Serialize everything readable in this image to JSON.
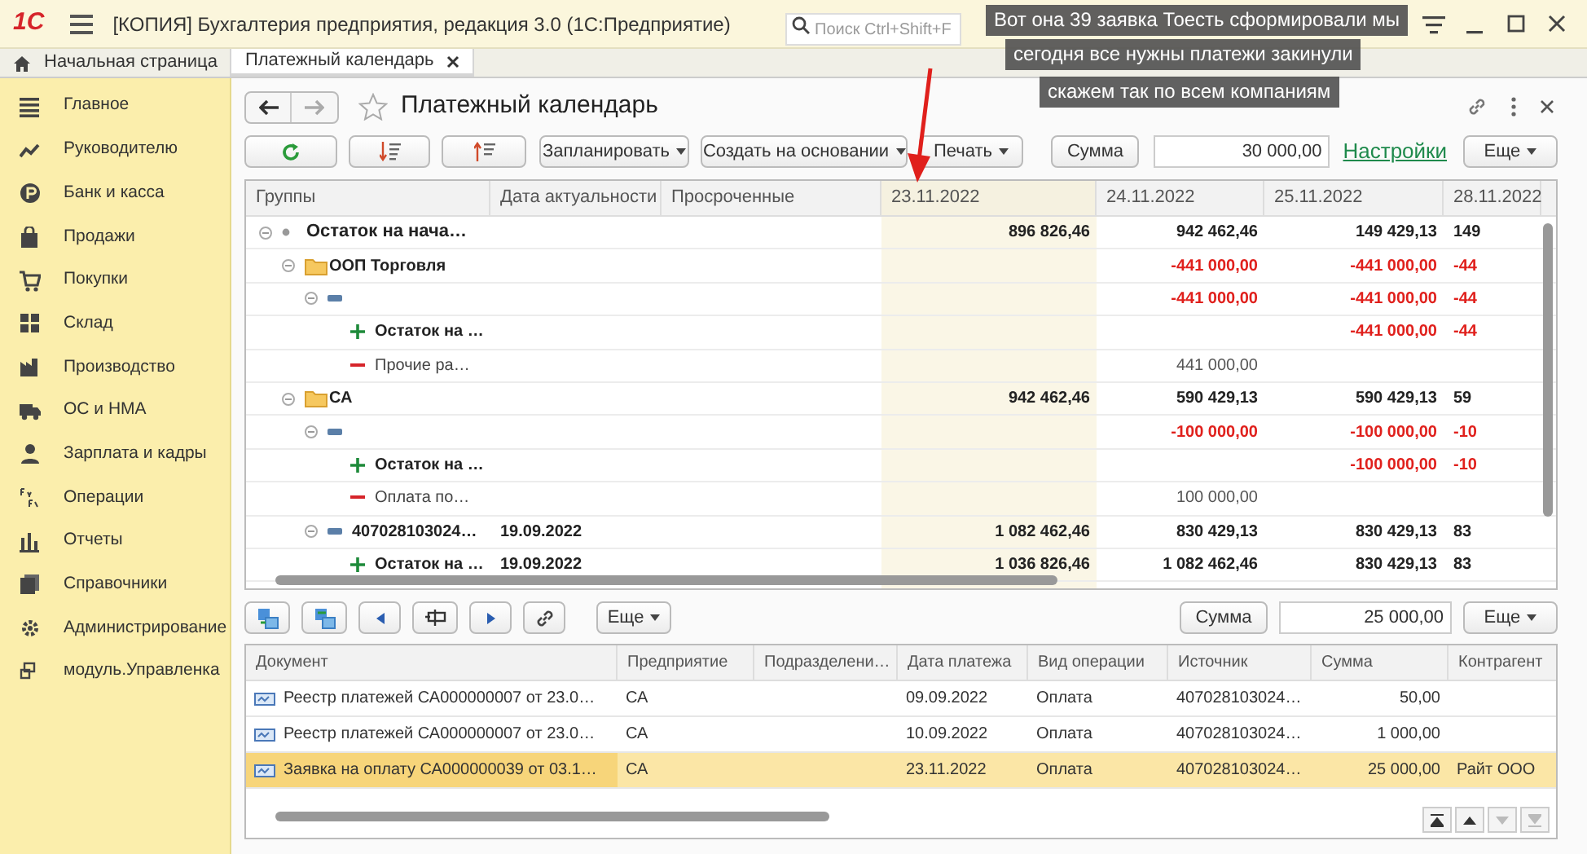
{
  "window": {
    "logo": "1С",
    "title": "[КОПИЯ] Бухгалтерия предприятия, редакция 3.0  (1С:Предприятие)",
    "search": {
      "placeholder": "Поиск Ctrl+Shift+F"
    }
  },
  "captions": [
    "Вот она 39 заявка Тоесть сформировали мы",
    "сегодня все нужны платежи закинули",
    "скажем так по всем компаниям"
  ],
  "tabs": [
    {
      "label": "Начальная страница",
      "selected": false,
      "closable": false
    },
    {
      "label": "Платежный календарь",
      "selected": true,
      "closable": true
    }
  ],
  "sidebar": {
    "items": [
      {
        "label": "Главное"
      },
      {
        "label": "Руководителю"
      },
      {
        "label": "Банк и касса"
      },
      {
        "label": "Продажи"
      },
      {
        "label": "Покупки"
      },
      {
        "label": "Склад"
      },
      {
        "label": "Производство"
      },
      {
        "label": "ОС и НМА"
      },
      {
        "label": "Зарплата и кадры"
      },
      {
        "label": "Операции"
      },
      {
        "label": "Отчеты"
      },
      {
        "label": "Справочники"
      },
      {
        "label": "Администрирование"
      },
      {
        "label": "модуль.Управленка"
      }
    ]
  },
  "form": {
    "title": "Платежный календарь",
    "toolbar": [
      {
        "kind": "refresh"
      },
      {
        "kind": "sort_desc"
      },
      {
        "kind": "sort_asc"
      },
      {
        "kind": "dropdown",
        "label": "Запланировать"
      },
      {
        "kind": "dropdown",
        "label": "Создать на основании"
      },
      {
        "kind": "dropdown",
        "label": "Печать"
      }
    ],
    "sum_button": "Сумма",
    "sum_value": "30 000,00",
    "settings_link": "Настройки",
    "more_button": "Еще",
    "grid": {
      "columns": [
        {
          "label": "Группы",
          "selected": false
        },
        {
          "label": "Дата актуальности",
          "selected": false
        },
        {
          "label": "Просроченные",
          "selected": false
        },
        {
          "label": "23.11.2022",
          "selected": true
        },
        {
          "label": "24.11.2022",
          "selected": false
        },
        {
          "label": "25.11.2022",
          "selected": false
        },
        {
          "label": "28.11.2022",
          "selected": false
        }
      ],
      "rows": [
        {
          "kind": "total",
          "label": "Остаток на нача…",
          "bold": true,
          "negative": false,
          "expanded": true,
          "values": {
            "column_4": "896 826,46",
            "column_5": "942 462,46",
            "column_6": "149 429,13",
            "column_7": "149"
          },
          "children": [
            {
              "kind": "group",
              "label": "ООП Торговля",
              "bold": true,
              "negative": true,
              "expanded": true,
              "values": {
                "column_5": "-441 000,00",
                "column_6": "-441 000,00",
                "column_7": "-44"
              },
              "children": [
                {
                  "kind": "subgroup",
                  "bold": true,
                  "negative": true,
                  "expanded": true,
                  "values": {
                    "column_5": "-441 000,00",
                    "column_6": "-441 000,00",
                    "column_7": "-44"
                  },
                  "children": [
                    {
                      "kind": "income",
                      "label": "Остаток на …",
                      "bold": true,
                      "negative": true,
                      "values": {
                        "column_6": "-441 000,00",
                        "column_7": "-44"
                      }
                    },
                    {
                      "kind": "expense",
                      "label": "Прочие ра…",
                      "bold": false,
                      "negative": false,
                      "values": {
                        "column_5": "441 000,00"
                      }
                    }
                  ]
                }
              ]
            },
            {
              "kind": "group",
              "label": "СА",
              "bold": true,
              "negative": false,
              "expanded": true,
              "values": {
                "column_4": "942 462,46",
                "column_5": "590 429,13",
                "column_6": "590 429,13",
                "column_7": "59"
              },
              "children": [
                {
                  "kind": "subgroup",
                  "bold": true,
                  "negative": true,
                  "expanded": true,
                  "values": {
                    "column_5": "-100 000,00",
                    "column_6": "-100 000,00",
                    "column_7": "-10"
                  },
                  "children": [
                    {
                      "kind": "income",
                      "label": "Остаток на …",
                      "bold": true,
                      "negative": true,
                      "values": {
                        "column_6": "-100 000,00",
                        "column_7": "-10"
                      }
                    },
                    {
                      "kind": "expense",
                      "label": "Оплата по…",
                      "bold": false,
                      "negative": false,
                      "values": {
                        "column_5": "100 000,00"
                      }
                    }
                  ]
                },
                {
                  "kind": "subgroup",
                  "label": "407028103024…",
                  "date": "19.09.2022",
                  "bold": true,
                  "negative": false,
                  "expanded": true,
                  "values": {
                    "column_4": "1 082 462,46",
                    "column_5": "830 429,13",
                    "column_6": "830 429,13",
                    "column_7": "83"
                  },
                  "children": [
                    {
                      "kind": "income",
                      "label": "Остаток на …",
                      "date": "19.09.2022",
                      "bold": true,
                      "negative": false,
                      "values": {
                        "column_4": "1 036 826,46",
                        "column_5": "1 082 462,46",
                        "column_6": "830 429,13",
                        "column_7": "83"
                      }
                    }
                  ]
                }
              ]
            }
          ]
        }
      ]
    },
    "bottom_toolbar": [
      {
        "kind": "move_in"
      },
      {
        "kind": "move_out"
      },
      {
        "kind": "prev"
      },
      {
        "kind": "split"
      },
      {
        "kind": "next"
      },
      {
        "kind": "link"
      },
      {
        "kind": "dropdown",
        "label": "Еще"
      }
    ],
    "bottom_sum_button": "Сумма",
    "bottom_sum_value": "25 000,00",
    "bottom_more_button": "Еще",
    "table": {
      "columns": [
        "Документ",
        "Предприятие",
        "Подразделени…",
        "Дата платежа",
        "Вид операции",
        "Источник",
        "Сумма",
        "Контрагент"
      ],
      "rows": [
        {
          "selected": false,
          "document": "Реестр платежей СА000000007 от 23.0…",
          "enterprise": "СА",
          "payment_date": "09.09.2022",
          "operation": "Оплата",
          "source": "407028103024…",
          "amount": "50,00"
        },
        {
          "selected": false,
          "document": "Реестр платежей СА000000007 от 23.0…",
          "enterprise": "СА",
          "payment_date": "10.09.2022",
          "operation": "Оплата",
          "source": "407028103024…",
          "amount": "1 000,00"
        },
        {
          "selected": true,
          "document": "Заявка на оплату СА000000039 от 03.1…",
          "enterprise": "СА",
          "payment_date": "23.11.2022",
          "operation": "Оплата",
          "source": "407028103024…",
          "amount": "25 000,00",
          "counterparty": "Райт ООО"
        }
      ]
    }
  }
}
